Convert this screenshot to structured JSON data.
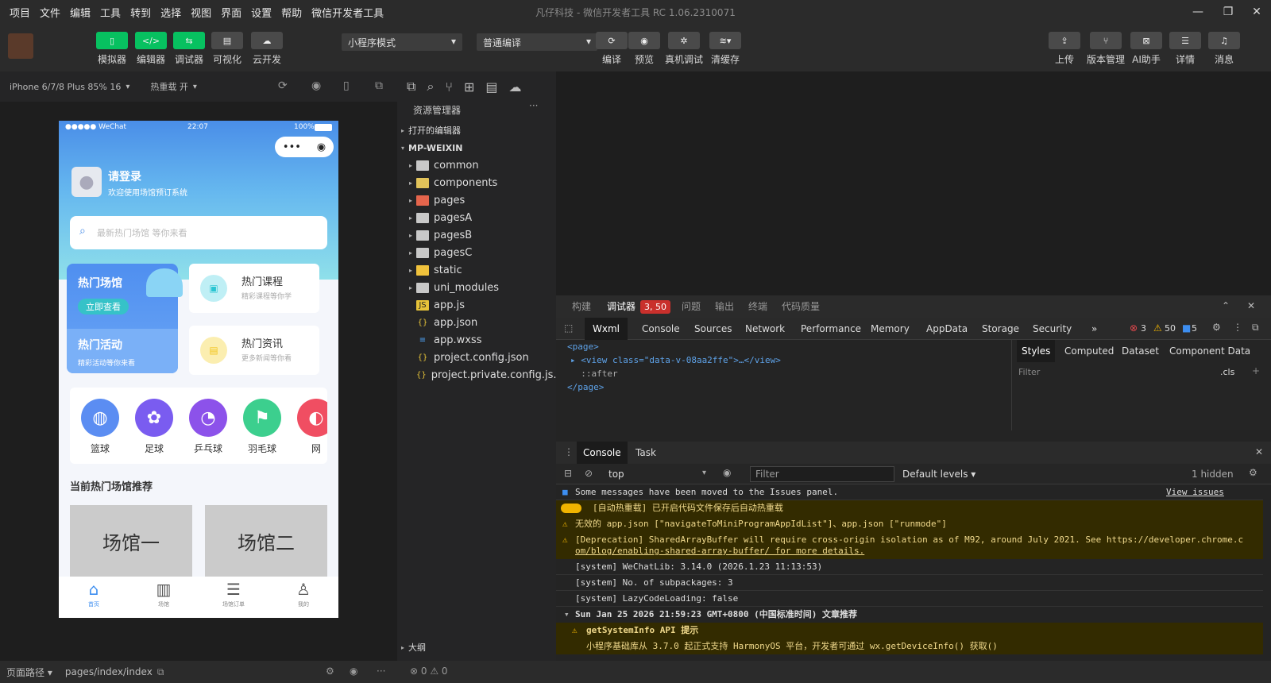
{
  "menu": [
    "项目",
    "文件",
    "编辑",
    "工具",
    "转到",
    "选择",
    "视图",
    "界面",
    "设置",
    "帮助",
    "微信开发者工具"
  ],
  "title": "凡仔科技 - 微信开发者工具 RC 1.06.2310071",
  "window_controls": [
    "—",
    "❐",
    "✕"
  ],
  "toolbar": {
    "left_buttons": [
      {
        "label": "模拟器",
        "icon": "phone-icon"
      },
      {
        "label": "编辑器",
        "icon": "code-icon"
      },
      {
        "label": "调试器",
        "icon": "debug-icon"
      },
      {
        "label": "可视化",
        "icon": "layout-icon"
      },
      {
        "label": "云开发",
        "icon": "cloud-icon"
      }
    ],
    "mode": "小程序模式",
    "compile": "普通编译",
    "mid_buttons": [
      {
        "label": "编译",
        "icon": "refresh-icon"
      },
      {
        "label": "预览",
        "icon": "eye-icon"
      },
      {
        "label": "真机调试",
        "icon": "bug-icon"
      },
      {
        "label": "清缓存",
        "icon": "layers-icon"
      }
    ],
    "right_buttons": [
      {
        "label": "上传",
        "icon": "upload-icon"
      },
      {
        "label": "版本管理",
        "icon": "branch-icon"
      },
      {
        "label": "AI助手",
        "icon": "ai-icon"
      },
      {
        "label": "详情",
        "icon": "menu-icon"
      },
      {
        "label": "消息",
        "icon": "bell-icon"
      }
    ]
  },
  "simulator": {
    "device": "iPhone 6/7/8 Plus 85% 16",
    "hotreload": "热重载 开",
    "phone": {
      "carrier": "●●●●● WeChat",
      "time": "22:07",
      "battery": "100%",
      "login_title": "请登录",
      "login_sub": "欢迎使用场馆预订系统",
      "search_placeholder": "最新热门场馆 等你来看",
      "hot_venue": "热门场馆",
      "view_now": "立即查看",
      "hot_activity": "热门活动",
      "activity_sub": "精彩活动等你来看",
      "hot_course": "热门课程",
      "course_sub": "精彩课程等你学",
      "hot_news": "热门资讯",
      "news_sub": "更多新闻等你看",
      "categories": [
        "篮球",
        "足球",
        "乒乓球",
        "羽毛球",
        "网"
      ],
      "recommend_title": "当前热门场馆推荐",
      "venues": [
        "场馆一",
        "场馆二"
      ],
      "tabs": [
        "首页",
        "场馆",
        "场馆订单",
        "我的"
      ]
    }
  },
  "explorer": {
    "title": "资源管理器",
    "open_editors": "打开的编辑器",
    "project": "MP-WEIXIN",
    "folders": [
      "common",
      "components",
      "pages",
      "pagesA",
      "pagesB",
      "pagesC",
      "static",
      "uni_modules"
    ],
    "files": [
      "app.js",
      "app.json",
      "app.wxss",
      "project.config.json",
      "project.private.config.js..."
    ],
    "outline": "大纲",
    "status_counts": "⊗ 0 ⚠ 0"
  },
  "devtools": {
    "top_tabs": [
      "构建",
      "调试器",
      "问题",
      "输出",
      "终端",
      "代码质量"
    ],
    "badge": "3, 50",
    "panel_tabs": [
      "Wxml",
      "Console",
      "Sources",
      "Network",
      "Performance",
      "Memory",
      "AppData",
      "Storage",
      "Security",
      "»"
    ],
    "error_count": "3",
    "warn_count": "50",
    "info_count": "5",
    "wxml": [
      "<page>",
      "▸ <view class=\"data-v-08aa2ffe\">…</view>",
      "  ::after",
      "</page>"
    ],
    "style_tabs": [
      "Styles",
      "Computed",
      "Dataset",
      "Component Data"
    ],
    "filter_placeholder": "Filter",
    "cls": ".cls",
    "drawer_tabs": [
      "Console",
      "Task"
    ],
    "context": "top",
    "console_filter": "Filter",
    "levels": "Default levels ▾",
    "hidden": "1 hidden",
    "view_issues": "View issues",
    "console": [
      "Some messages have been moved to the Issues panel.",
      "[自动热重载] 已开启代码文件保存后自动热重载",
      "无效的 app.json [\"navigateToMiniProgramAppIdList\"]、app.json [\"runmode\"]",
      "[Deprecation] SharedArrayBuffer will require cross-origin isolation as of M92, around July 2021. See https://developer.chrome.c",
      "om/blog/enabling-shared-array-buffer/ for more details.",
      "[system] WeChatLib: 3.14.0 (2026.1.23 11:13:53)",
      "[system] No. of subpackages: 3",
      "[system] LazyCodeLoading: false",
      "Sun Jan 25 2026 21:59:23 GMT+0800 (中国标准时间) 文章推荐",
      "getSystemInfo API 提示",
      "小程序基础库从 3.7.0 起正式支持 HarmonyOS 平台，开发者可通过 wx.getDeviceInfo() 获取()"
    ]
  },
  "status": {
    "path_label": "页面路径 ▾",
    "path": "pages/index/index"
  },
  "colors": {
    "accent": "#07c160",
    "warn": "#f0b400",
    "error": "#e5484d"
  }
}
